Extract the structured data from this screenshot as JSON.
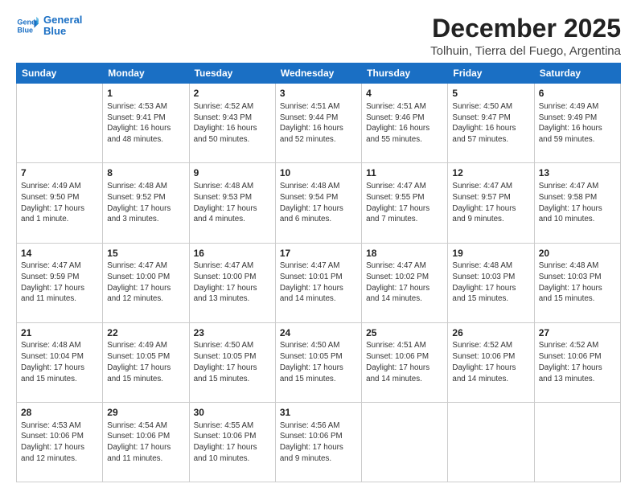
{
  "logo": {
    "line1": "General",
    "line2": "Blue"
  },
  "title": "December 2025",
  "subtitle": "Tolhuin, Tierra del Fuego, Argentina",
  "weekdays": [
    "Sunday",
    "Monday",
    "Tuesday",
    "Wednesday",
    "Thursday",
    "Friday",
    "Saturday"
  ],
  "weeks": [
    [
      {
        "day": "",
        "info": ""
      },
      {
        "day": "1",
        "info": "Sunrise: 4:53 AM\nSunset: 9:41 PM\nDaylight: 16 hours\nand 48 minutes."
      },
      {
        "day": "2",
        "info": "Sunrise: 4:52 AM\nSunset: 9:43 PM\nDaylight: 16 hours\nand 50 minutes."
      },
      {
        "day": "3",
        "info": "Sunrise: 4:51 AM\nSunset: 9:44 PM\nDaylight: 16 hours\nand 52 minutes."
      },
      {
        "day": "4",
        "info": "Sunrise: 4:51 AM\nSunset: 9:46 PM\nDaylight: 16 hours\nand 55 minutes."
      },
      {
        "day": "5",
        "info": "Sunrise: 4:50 AM\nSunset: 9:47 PM\nDaylight: 16 hours\nand 57 minutes."
      },
      {
        "day": "6",
        "info": "Sunrise: 4:49 AM\nSunset: 9:49 PM\nDaylight: 16 hours\nand 59 minutes."
      }
    ],
    [
      {
        "day": "7",
        "info": "Sunrise: 4:49 AM\nSunset: 9:50 PM\nDaylight: 17 hours\nand 1 minute."
      },
      {
        "day": "8",
        "info": "Sunrise: 4:48 AM\nSunset: 9:52 PM\nDaylight: 17 hours\nand 3 minutes."
      },
      {
        "day": "9",
        "info": "Sunrise: 4:48 AM\nSunset: 9:53 PM\nDaylight: 17 hours\nand 4 minutes."
      },
      {
        "day": "10",
        "info": "Sunrise: 4:48 AM\nSunset: 9:54 PM\nDaylight: 17 hours\nand 6 minutes."
      },
      {
        "day": "11",
        "info": "Sunrise: 4:47 AM\nSunset: 9:55 PM\nDaylight: 17 hours\nand 7 minutes."
      },
      {
        "day": "12",
        "info": "Sunrise: 4:47 AM\nSunset: 9:57 PM\nDaylight: 17 hours\nand 9 minutes."
      },
      {
        "day": "13",
        "info": "Sunrise: 4:47 AM\nSunset: 9:58 PM\nDaylight: 17 hours\nand 10 minutes."
      }
    ],
    [
      {
        "day": "14",
        "info": "Sunrise: 4:47 AM\nSunset: 9:59 PM\nDaylight: 17 hours\nand 11 minutes."
      },
      {
        "day": "15",
        "info": "Sunrise: 4:47 AM\nSunset: 10:00 PM\nDaylight: 17 hours\nand 12 minutes."
      },
      {
        "day": "16",
        "info": "Sunrise: 4:47 AM\nSunset: 10:00 PM\nDaylight: 17 hours\nand 13 minutes."
      },
      {
        "day": "17",
        "info": "Sunrise: 4:47 AM\nSunset: 10:01 PM\nDaylight: 17 hours\nand 14 minutes."
      },
      {
        "day": "18",
        "info": "Sunrise: 4:47 AM\nSunset: 10:02 PM\nDaylight: 17 hours\nand 14 minutes."
      },
      {
        "day": "19",
        "info": "Sunrise: 4:48 AM\nSunset: 10:03 PM\nDaylight: 17 hours\nand 15 minutes."
      },
      {
        "day": "20",
        "info": "Sunrise: 4:48 AM\nSunset: 10:03 PM\nDaylight: 17 hours\nand 15 minutes."
      }
    ],
    [
      {
        "day": "21",
        "info": "Sunrise: 4:48 AM\nSunset: 10:04 PM\nDaylight: 17 hours\nand 15 minutes."
      },
      {
        "day": "22",
        "info": "Sunrise: 4:49 AM\nSunset: 10:05 PM\nDaylight: 17 hours\nand 15 minutes."
      },
      {
        "day": "23",
        "info": "Sunrise: 4:50 AM\nSunset: 10:05 PM\nDaylight: 17 hours\nand 15 minutes."
      },
      {
        "day": "24",
        "info": "Sunrise: 4:50 AM\nSunset: 10:05 PM\nDaylight: 17 hours\nand 15 minutes."
      },
      {
        "day": "25",
        "info": "Sunrise: 4:51 AM\nSunset: 10:06 PM\nDaylight: 17 hours\nand 14 minutes."
      },
      {
        "day": "26",
        "info": "Sunrise: 4:52 AM\nSunset: 10:06 PM\nDaylight: 17 hours\nand 14 minutes."
      },
      {
        "day": "27",
        "info": "Sunrise: 4:52 AM\nSunset: 10:06 PM\nDaylight: 17 hours\nand 13 minutes."
      }
    ],
    [
      {
        "day": "28",
        "info": "Sunrise: 4:53 AM\nSunset: 10:06 PM\nDaylight: 17 hours\nand 12 minutes."
      },
      {
        "day": "29",
        "info": "Sunrise: 4:54 AM\nSunset: 10:06 PM\nDaylight: 17 hours\nand 11 minutes."
      },
      {
        "day": "30",
        "info": "Sunrise: 4:55 AM\nSunset: 10:06 PM\nDaylight: 17 hours\nand 10 minutes."
      },
      {
        "day": "31",
        "info": "Sunrise: 4:56 AM\nSunset: 10:06 PM\nDaylight: 17 hours\nand 9 minutes."
      },
      {
        "day": "",
        "info": ""
      },
      {
        "day": "",
        "info": ""
      },
      {
        "day": "",
        "info": ""
      }
    ]
  ]
}
